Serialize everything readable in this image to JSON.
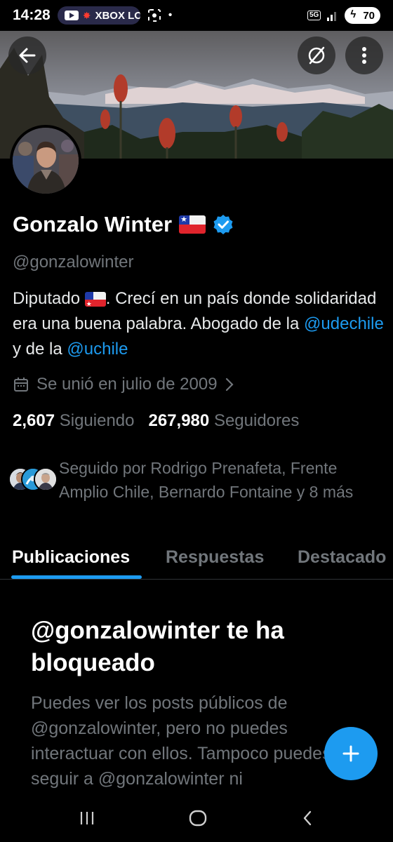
{
  "status_bar": {
    "time": "14:28",
    "notification_text": "XBOX LO",
    "network": "5G",
    "battery": "70"
  },
  "header": {
    "back_icon": "arrow-left-icon",
    "grok_icon": "grok-icon",
    "more_icon": "more-vertical-icon"
  },
  "profile": {
    "name": "Gonzalo Winter",
    "verified": true,
    "handle": "@gonzalowinter",
    "bio": {
      "part1": "Diputado ",
      "part2": ". Crecí en un país donde solidaridad era una buena palabra. Abogado de la ",
      "mention1": "@udechile",
      "part3": " y de la ",
      "mention2": "@uchile"
    },
    "joined": "Se unió en julio de 2009",
    "following_count": "2,607",
    "following_label": "Siguiendo",
    "followers_count": "267,980",
    "followers_label": "Seguidores",
    "followed_by": "Seguido por Rodrigo Prenafeta, Frente Amplio Chile, Bernardo Fontaine y 8 más"
  },
  "tabs": [
    {
      "label": "Publicaciones",
      "active": true
    },
    {
      "label": "Respuestas",
      "active": false
    },
    {
      "label": "Destacado",
      "active": false
    }
  ],
  "blocked": {
    "title": "@gonzalowinter te ha bloqueado",
    "text": "Puedes ver los posts públicos de @gonzalowinter, pero no puedes interactuar con ellos. Tampoco puedes seguir a @gonzalowinter ni"
  },
  "colors": {
    "accent": "#1d9bf0",
    "background": "#000000",
    "secondary_text": "#71767b"
  }
}
